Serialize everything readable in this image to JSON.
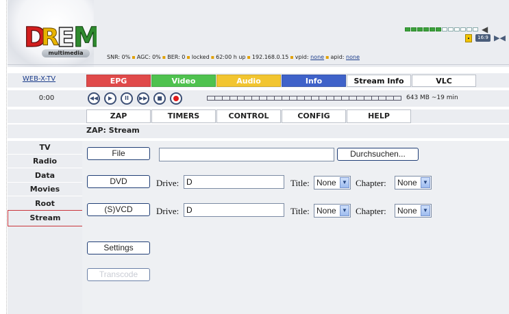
{
  "header": {
    "logo_sub": "multimedia",
    "status": {
      "snr": "SNR: 0%",
      "agc": "AGC: 0%",
      "ber": "BER: 0",
      "lock": "locked",
      "uptime": "62:00 h up",
      "ip": "192.168.0.15",
      "vpid_label": "vpid:",
      "vpid_value": "none",
      "apid_label": "apid:",
      "apid_value": "none"
    },
    "volume_level": 0.5,
    "aspect_badge": "16:9"
  },
  "tabs": {
    "web_tv": "WEB-X-TV",
    "items": [
      {
        "label": "EPG",
        "color": "#e04a4a"
      },
      {
        "label": "Video",
        "color": "#4fc24f"
      },
      {
        "label": "Audio",
        "color": "#f2c530"
      },
      {
        "label": "Info",
        "color": "#3f62c9"
      },
      {
        "label": "Stream Info",
        "color": "#ffffff"
      },
      {
        "label": "VLC",
        "color": "#ffffff"
      }
    ]
  },
  "player": {
    "time": "0:00",
    "info": "643 MB ~19 min"
  },
  "menu": [
    "ZAP",
    "TIMERS",
    "CONTROL",
    "CONFIG",
    "HELP"
  ],
  "breadcrumb": "ZAP: Stream",
  "sidebar": [
    "TV",
    "Radio",
    "Data",
    "Movies",
    "Root",
    "Stream"
  ],
  "content": {
    "file_btn": "File",
    "file_value": "",
    "browse_btn": "Durchsuchen...",
    "dvd_btn": "DVD",
    "svcd_btn": "(S)VCD",
    "drive_label": "Drive:",
    "drive_value": "D",
    "title_label": "Title:",
    "title_value": "None",
    "chapter_label": "Chapter:",
    "chapter_value": "None",
    "settings_btn": "Settings",
    "transcode_btn": "Transcode"
  }
}
